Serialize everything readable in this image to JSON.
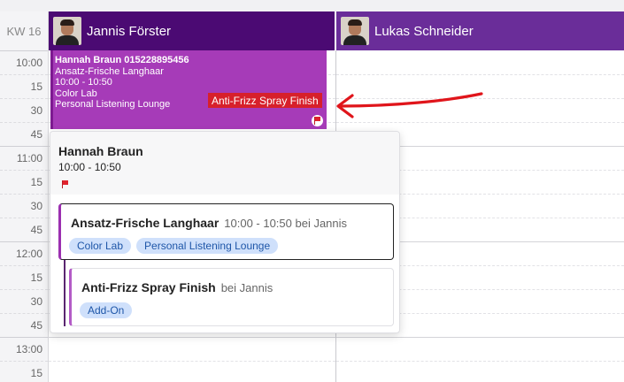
{
  "calendar": {
    "week_label": "KW 16",
    "time_labels": [
      "10:00",
      "15",
      "30",
      "45",
      "11:00",
      "15",
      "30",
      "45",
      "12:00",
      "15",
      "30",
      "45",
      "13:00",
      "15"
    ]
  },
  "staff": [
    {
      "name": "Jannis Förster"
    },
    {
      "name": "Lukas Schneider"
    }
  ],
  "event": {
    "client_phone": "Hannah Braun 015228895456",
    "service": "Ansatz-Frische Langhaar",
    "time": "10:00 - 10:50",
    "resource1": "Color Lab",
    "resource2": "Personal Listening Lounge",
    "addon_tag": "Anti-Frizz Spray Finish",
    "flag_icon": "flag-icon"
  },
  "popover": {
    "client_name": "Hannah Braun",
    "time": "10:00 - 10:50",
    "card1": {
      "title": "Ansatz-Frische Langhaar",
      "meta": "10:00 - 10:50 bei Jannis",
      "chips": [
        "Color Lab",
        "Personal Listening Lounge"
      ]
    },
    "card2": {
      "title": "Anti-Frizz Spray Finish",
      "meta": "bei Jannis",
      "chips": [
        "Add-On"
      ]
    }
  },
  "colors": {
    "jannis_header": "#4b0a73",
    "lukas_header": "#6a2d99",
    "event_bg": "#a63bb8",
    "addon_tag": "#d7202b",
    "chip_bg": "#cfe0fb",
    "arrow": "#e0151b"
  }
}
